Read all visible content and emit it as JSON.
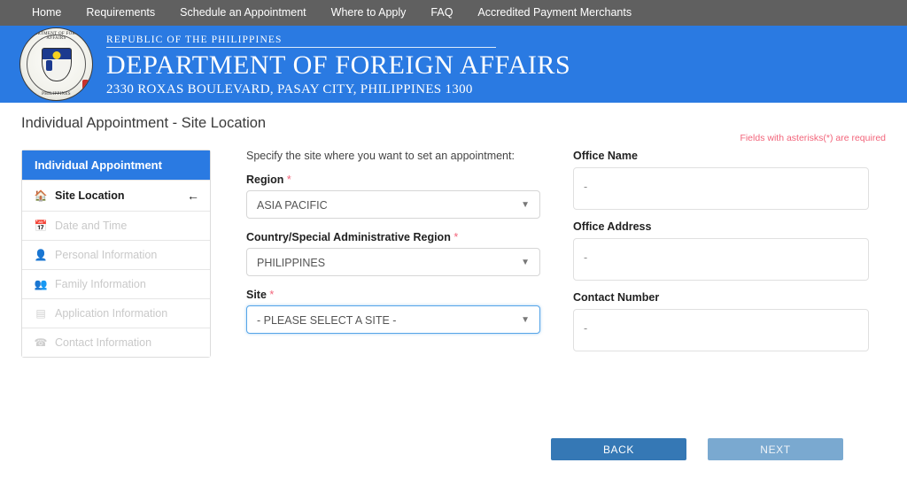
{
  "topnav": {
    "items": [
      {
        "label": "Home"
      },
      {
        "label": "Requirements"
      },
      {
        "label": "Schedule an Appointment"
      },
      {
        "label": "Where to Apply"
      },
      {
        "label": "FAQ"
      },
      {
        "label": "Accredited Payment Merchants"
      }
    ]
  },
  "banner": {
    "seal_top_text": "DEPARTMENT OF FOREIGN AFFAIRS",
    "seal_bottom_text": "PHILIPPINES",
    "line1": "REPUBLIC OF THE PHILIPPINES",
    "line2": "DEPARTMENT OF FOREIGN AFFAIRS",
    "line3": "2330 ROXAS BOULEVARD, PASAY CITY, PHILIPPINES 1300",
    "bg_color": "#2a7ae2"
  },
  "page": {
    "title": "Individual Appointment - Site Location",
    "required_note": "Fields with asterisks(*) are required",
    "required_note_color": "#f2647a"
  },
  "sidebar": {
    "header": "Individual Appointment",
    "header_color": "#2a7ae2",
    "items": [
      {
        "label": "Site Location",
        "icon": "home-icon",
        "glyph": "⌂",
        "state": "active",
        "arrow": "←"
      },
      {
        "label": "Date and Time",
        "icon": "calendar-icon",
        "glyph": "Ὄ5",
        "state": "disabled"
      },
      {
        "label": "Personal Information",
        "icon": "user-icon",
        "glyph": "὆4",
        "state": "disabled"
      },
      {
        "label": "Family Information",
        "icon": "users-icon",
        "glyph": "὆5",
        "state": "disabled"
      },
      {
        "label": "Application Information",
        "icon": "list-card-icon",
        "glyph": "▤",
        "state": "disabled"
      },
      {
        "label": "Contact Information",
        "icon": "phone-icon",
        "glyph": "☎",
        "state": "disabled"
      }
    ]
  },
  "form": {
    "intro": "Specify the site where you want to set an appointment:",
    "region": {
      "label": "Region",
      "required_mark": "*",
      "value": "ASIA PACIFIC",
      "options": [
        "ASIA PACIFIC"
      ]
    },
    "country": {
      "label": "Country/Special Administrative Region",
      "required_mark": "*",
      "value": "PHILIPPINES",
      "options": [
        "PHILIPPINES"
      ]
    },
    "site": {
      "label": "Site",
      "required_mark": "*",
      "value": "- PLEASE SELECT A SITE -",
      "options": [
        "- PLEASE SELECT A SITE -"
      ],
      "focused": true
    }
  },
  "office": {
    "name": {
      "label": "Office Name",
      "value": "-"
    },
    "address": {
      "label": "Office Address",
      "value": "-"
    },
    "contact": {
      "label": "Contact Number",
      "value": "-"
    }
  },
  "buttons": {
    "back": {
      "label": "BACK",
      "color": "#3578b5"
    },
    "next": {
      "label": "NEXT",
      "color": "#7aa9d0"
    }
  }
}
